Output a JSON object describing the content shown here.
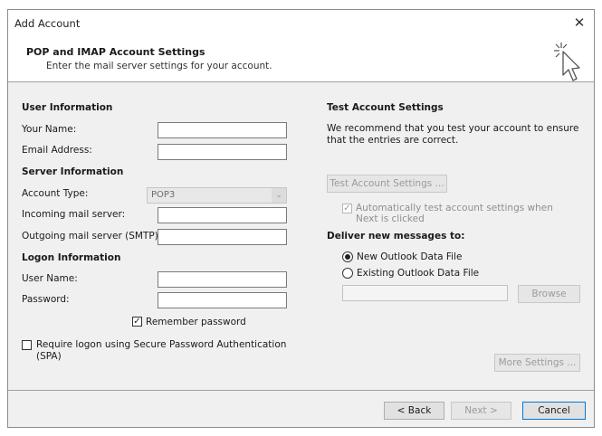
{
  "window": {
    "title": "Add Account",
    "close_glyph": "✕"
  },
  "header": {
    "title": "POP and IMAP Account Settings",
    "subtitle": "Enter the mail server settings for your account.",
    "icon": "cursor-click-icon"
  },
  "user_information": {
    "heading": "User Information",
    "your_name": {
      "label": "Your Name:",
      "value": ""
    },
    "email_address": {
      "label": "Email Address:",
      "value": ""
    }
  },
  "server_information": {
    "heading": "Server Information",
    "account_type": {
      "label": "Account Type:",
      "value": "POP3"
    },
    "incoming": {
      "label": "Incoming mail server:",
      "value": ""
    },
    "outgoing": {
      "label": "Outgoing mail server (SMTP):",
      "value": ""
    }
  },
  "logon_information": {
    "heading": "Logon Information",
    "user_name": {
      "label": "User Name:",
      "value": ""
    },
    "password": {
      "label": "Password:",
      "value": ""
    },
    "remember_password": {
      "label": "Remember password",
      "checked": true
    },
    "spa": {
      "label": "Require logon using Secure Password Authentication (SPA)",
      "checked": false
    }
  },
  "test_settings": {
    "heading": "Test Account Settings",
    "description": "We recommend that you test your account to ensure that the entries are correct.",
    "test_button": "Test Account Settings ...",
    "auto_test": {
      "label": "Automatically test account settings when Next is clicked",
      "checked": true
    }
  },
  "deliver": {
    "heading": "Deliver new messages to:",
    "new_file": {
      "label": "New Outlook Data File",
      "selected": true
    },
    "existing_file": {
      "label": "Existing Outlook Data File",
      "selected": false
    },
    "path_value": "",
    "browse_button": "Browse"
  },
  "more_settings_button": "More Settings ...",
  "footer": {
    "back": "< Back",
    "next": "Next >",
    "cancel": "Cancel"
  },
  "colors": {
    "panel_bg": "#f0f0f0",
    "focus_border": "#0078d7"
  }
}
